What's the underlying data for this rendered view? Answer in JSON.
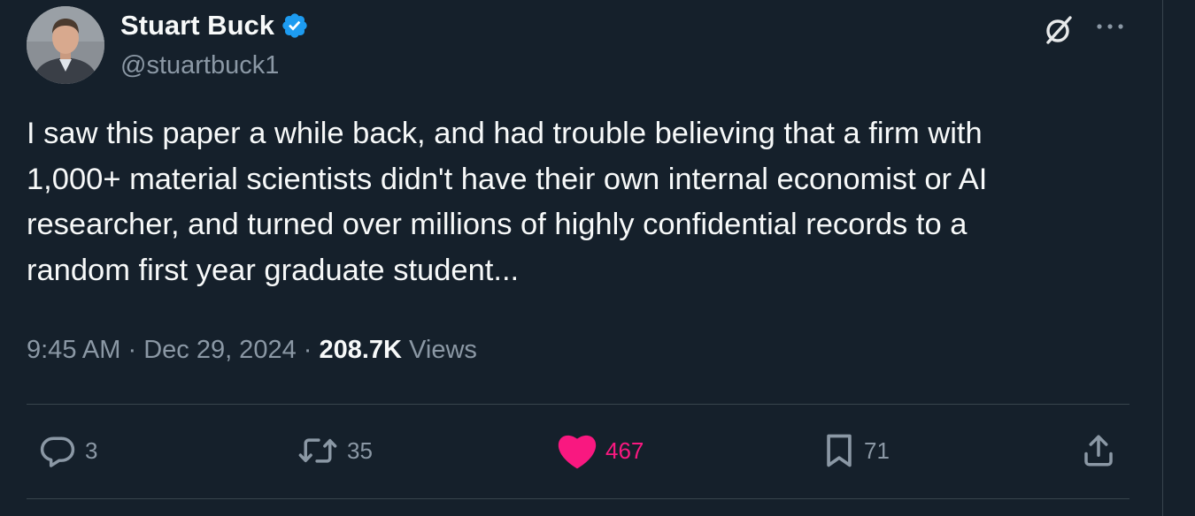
{
  "author": {
    "name": "Stuart Buck",
    "handle": "@stuartbuck1",
    "verified_color": "#1d9bf0"
  },
  "tweet": {
    "lines": [
      "I saw this paper a while back, and had trouble believing that a firm with",
      "1,000+ material scientists didn't have their own internal economist or AI",
      "researcher, and turned over millions of highly confidential records to a",
      "random first year graduate student..."
    ]
  },
  "meta": {
    "time": "9:45 AM",
    "separator": " · ",
    "date": "Dec 29, 2024",
    "views_count": "208.7K",
    "views_label": " Views"
  },
  "actions": {
    "replies": "3",
    "reposts": "35",
    "likes": "467",
    "bookmarks": "71"
  },
  "colors": {
    "background": "#15202b",
    "like": "#f91880",
    "muted": "#8b98a5"
  },
  "icons": [
    "grok-icon",
    "more-icon",
    "reply-icon",
    "repost-icon",
    "like-icon",
    "bookmark-icon",
    "share-icon",
    "verified-badge-icon"
  ]
}
